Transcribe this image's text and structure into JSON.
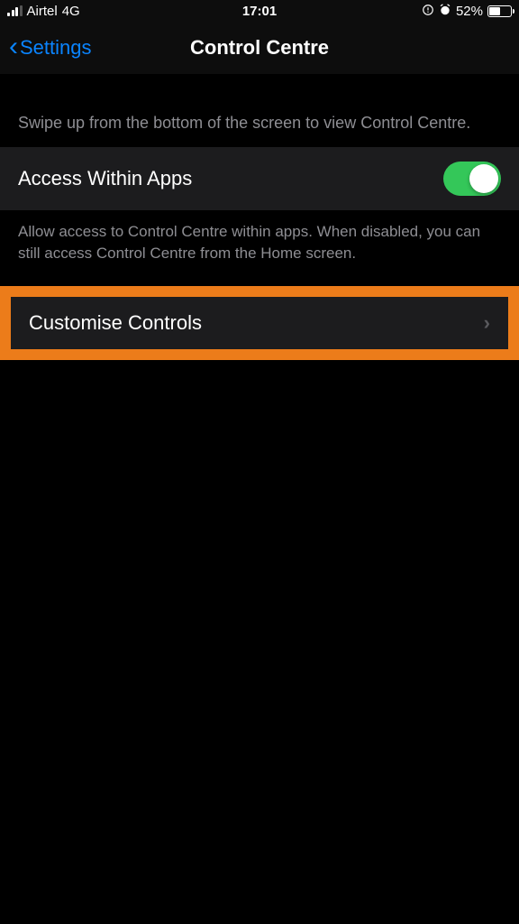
{
  "statusBar": {
    "carrier": "Airtel",
    "network": "4G",
    "time": "17:01",
    "batteryPercent": "52%"
  },
  "nav": {
    "back": "Settings",
    "title": "Control Centre"
  },
  "intro": "Swipe up from the bottom of the screen to view Control Centre.",
  "accessRow": {
    "label": "Access Within Apps",
    "enabled": true
  },
  "accessFooter": "Allow access to Control Centre within apps. When disabled, you can still access Control Centre from the Home screen.",
  "customiseRow": {
    "label": "Customise Controls"
  }
}
